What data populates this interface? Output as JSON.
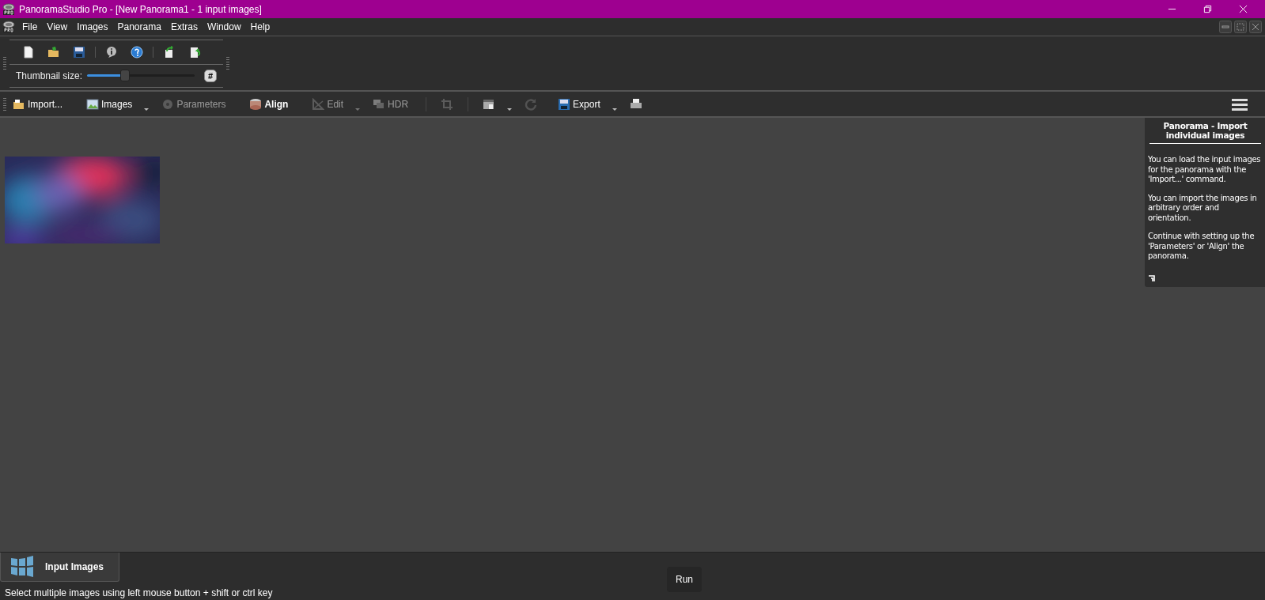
{
  "window": {
    "title": "PanoramaStudio Pro - [New Panorama1 - 1 input images]"
  },
  "menu": [
    "File",
    "View",
    "Images",
    "Panorama",
    "Extras",
    "Window",
    "Help"
  ],
  "quick_toolbar": {
    "thumbnail_label": "Thumbnail size:",
    "thumbnail_slider": {
      "level": 0.35
    },
    "grid_button": "#"
  },
  "main_toolbar": [
    {
      "kind": "button",
      "label": "Import...",
      "disabled": false,
      "bold": false,
      "dropdown": false
    },
    {
      "kind": "button",
      "label": "Images",
      "disabled": false,
      "bold": false,
      "dropdown": true
    },
    {
      "kind": "button",
      "label": "Parameters",
      "disabled": true,
      "bold": false,
      "dropdown": false
    },
    {
      "kind": "button",
      "label": "Align",
      "disabled": false,
      "bold": true,
      "dropdown": false
    },
    {
      "kind": "button",
      "label": "Edit",
      "disabled": true,
      "bold": false,
      "dropdown": true
    },
    {
      "kind": "button",
      "label": "HDR",
      "disabled": true,
      "bold": false,
      "dropdown": false
    },
    {
      "kind": "icon",
      "disabled": true,
      "dropdown": false
    },
    {
      "kind": "icon",
      "disabled": false,
      "dropdown": true
    },
    {
      "kind": "icon",
      "disabled": true,
      "dropdown": false
    },
    {
      "kind": "button",
      "label": "Export",
      "disabled": false,
      "bold": false,
      "dropdown": true
    },
    {
      "kind": "icon",
      "disabled": false,
      "dropdown": false
    }
  ],
  "help_panel": {
    "title": "Panorama - Import individual images",
    "paragraphs": [
      "You can load the input images for the panorama with the 'Import...' command.",
      "You can import the images in arbitrary order and orientation.",
      "Continue with setting up the 'Parameters' or 'Align' the panorama."
    ]
  },
  "bottom_tabs": [
    {
      "label": "Input Images",
      "selected": true
    }
  ],
  "run_button": "Run",
  "status_bar": "Select multiple images using left mouse button + shift or ctrl key"
}
